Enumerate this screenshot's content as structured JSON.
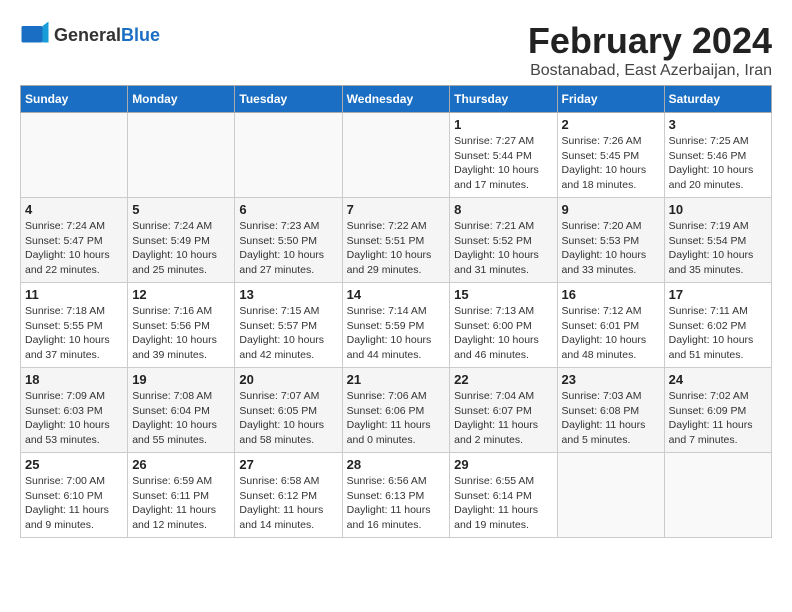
{
  "header": {
    "logo_general": "General",
    "logo_blue": "Blue",
    "month_title": "February 2024",
    "location": "Bostanabad, East Azerbaijan, Iran"
  },
  "weekdays": [
    "Sunday",
    "Monday",
    "Tuesday",
    "Wednesday",
    "Thursday",
    "Friday",
    "Saturday"
  ],
  "weeks": [
    [
      {
        "day": "",
        "info": ""
      },
      {
        "day": "",
        "info": ""
      },
      {
        "day": "",
        "info": ""
      },
      {
        "day": "",
        "info": ""
      },
      {
        "day": "1",
        "info": "Sunrise: 7:27 AM\nSunset: 5:44 PM\nDaylight: 10 hours\nand 17 minutes."
      },
      {
        "day": "2",
        "info": "Sunrise: 7:26 AM\nSunset: 5:45 PM\nDaylight: 10 hours\nand 18 minutes."
      },
      {
        "day": "3",
        "info": "Sunrise: 7:25 AM\nSunset: 5:46 PM\nDaylight: 10 hours\nand 20 minutes."
      }
    ],
    [
      {
        "day": "4",
        "info": "Sunrise: 7:24 AM\nSunset: 5:47 PM\nDaylight: 10 hours\nand 22 minutes."
      },
      {
        "day": "5",
        "info": "Sunrise: 7:24 AM\nSunset: 5:49 PM\nDaylight: 10 hours\nand 25 minutes."
      },
      {
        "day": "6",
        "info": "Sunrise: 7:23 AM\nSunset: 5:50 PM\nDaylight: 10 hours\nand 27 minutes."
      },
      {
        "day": "7",
        "info": "Sunrise: 7:22 AM\nSunset: 5:51 PM\nDaylight: 10 hours\nand 29 minutes."
      },
      {
        "day": "8",
        "info": "Sunrise: 7:21 AM\nSunset: 5:52 PM\nDaylight: 10 hours\nand 31 minutes."
      },
      {
        "day": "9",
        "info": "Sunrise: 7:20 AM\nSunset: 5:53 PM\nDaylight: 10 hours\nand 33 minutes."
      },
      {
        "day": "10",
        "info": "Sunrise: 7:19 AM\nSunset: 5:54 PM\nDaylight: 10 hours\nand 35 minutes."
      }
    ],
    [
      {
        "day": "11",
        "info": "Sunrise: 7:18 AM\nSunset: 5:55 PM\nDaylight: 10 hours\nand 37 minutes."
      },
      {
        "day": "12",
        "info": "Sunrise: 7:16 AM\nSunset: 5:56 PM\nDaylight: 10 hours\nand 39 minutes."
      },
      {
        "day": "13",
        "info": "Sunrise: 7:15 AM\nSunset: 5:57 PM\nDaylight: 10 hours\nand 42 minutes."
      },
      {
        "day": "14",
        "info": "Sunrise: 7:14 AM\nSunset: 5:59 PM\nDaylight: 10 hours\nand 44 minutes."
      },
      {
        "day": "15",
        "info": "Sunrise: 7:13 AM\nSunset: 6:00 PM\nDaylight: 10 hours\nand 46 minutes."
      },
      {
        "day": "16",
        "info": "Sunrise: 7:12 AM\nSunset: 6:01 PM\nDaylight: 10 hours\nand 48 minutes."
      },
      {
        "day": "17",
        "info": "Sunrise: 7:11 AM\nSunset: 6:02 PM\nDaylight: 10 hours\nand 51 minutes."
      }
    ],
    [
      {
        "day": "18",
        "info": "Sunrise: 7:09 AM\nSunset: 6:03 PM\nDaylight: 10 hours\nand 53 minutes."
      },
      {
        "day": "19",
        "info": "Sunrise: 7:08 AM\nSunset: 6:04 PM\nDaylight: 10 hours\nand 55 minutes."
      },
      {
        "day": "20",
        "info": "Sunrise: 7:07 AM\nSunset: 6:05 PM\nDaylight: 10 hours\nand 58 minutes."
      },
      {
        "day": "21",
        "info": "Sunrise: 7:06 AM\nSunset: 6:06 PM\nDaylight: 11 hours\nand 0 minutes."
      },
      {
        "day": "22",
        "info": "Sunrise: 7:04 AM\nSunset: 6:07 PM\nDaylight: 11 hours\nand 2 minutes."
      },
      {
        "day": "23",
        "info": "Sunrise: 7:03 AM\nSunset: 6:08 PM\nDaylight: 11 hours\nand 5 minutes."
      },
      {
        "day": "24",
        "info": "Sunrise: 7:02 AM\nSunset: 6:09 PM\nDaylight: 11 hours\nand 7 minutes."
      }
    ],
    [
      {
        "day": "25",
        "info": "Sunrise: 7:00 AM\nSunset: 6:10 PM\nDaylight: 11 hours\nand 9 minutes."
      },
      {
        "day": "26",
        "info": "Sunrise: 6:59 AM\nSunset: 6:11 PM\nDaylight: 11 hours\nand 12 minutes."
      },
      {
        "day": "27",
        "info": "Sunrise: 6:58 AM\nSunset: 6:12 PM\nDaylight: 11 hours\nand 14 minutes."
      },
      {
        "day": "28",
        "info": "Sunrise: 6:56 AM\nSunset: 6:13 PM\nDaylight: 11 hours\nand 16 minutes."
      },
      {
        "day": "29",
        "info": "Sunrise: 6:55 AM\nSunset: 6:14 PM\nDaylight: 11 hours\nand 19 minutes."
      },
      {
        "day": "",
        "info": ""
      },
      {
        "day": "",
        "info": ""
      }
    ]
  ]
}
